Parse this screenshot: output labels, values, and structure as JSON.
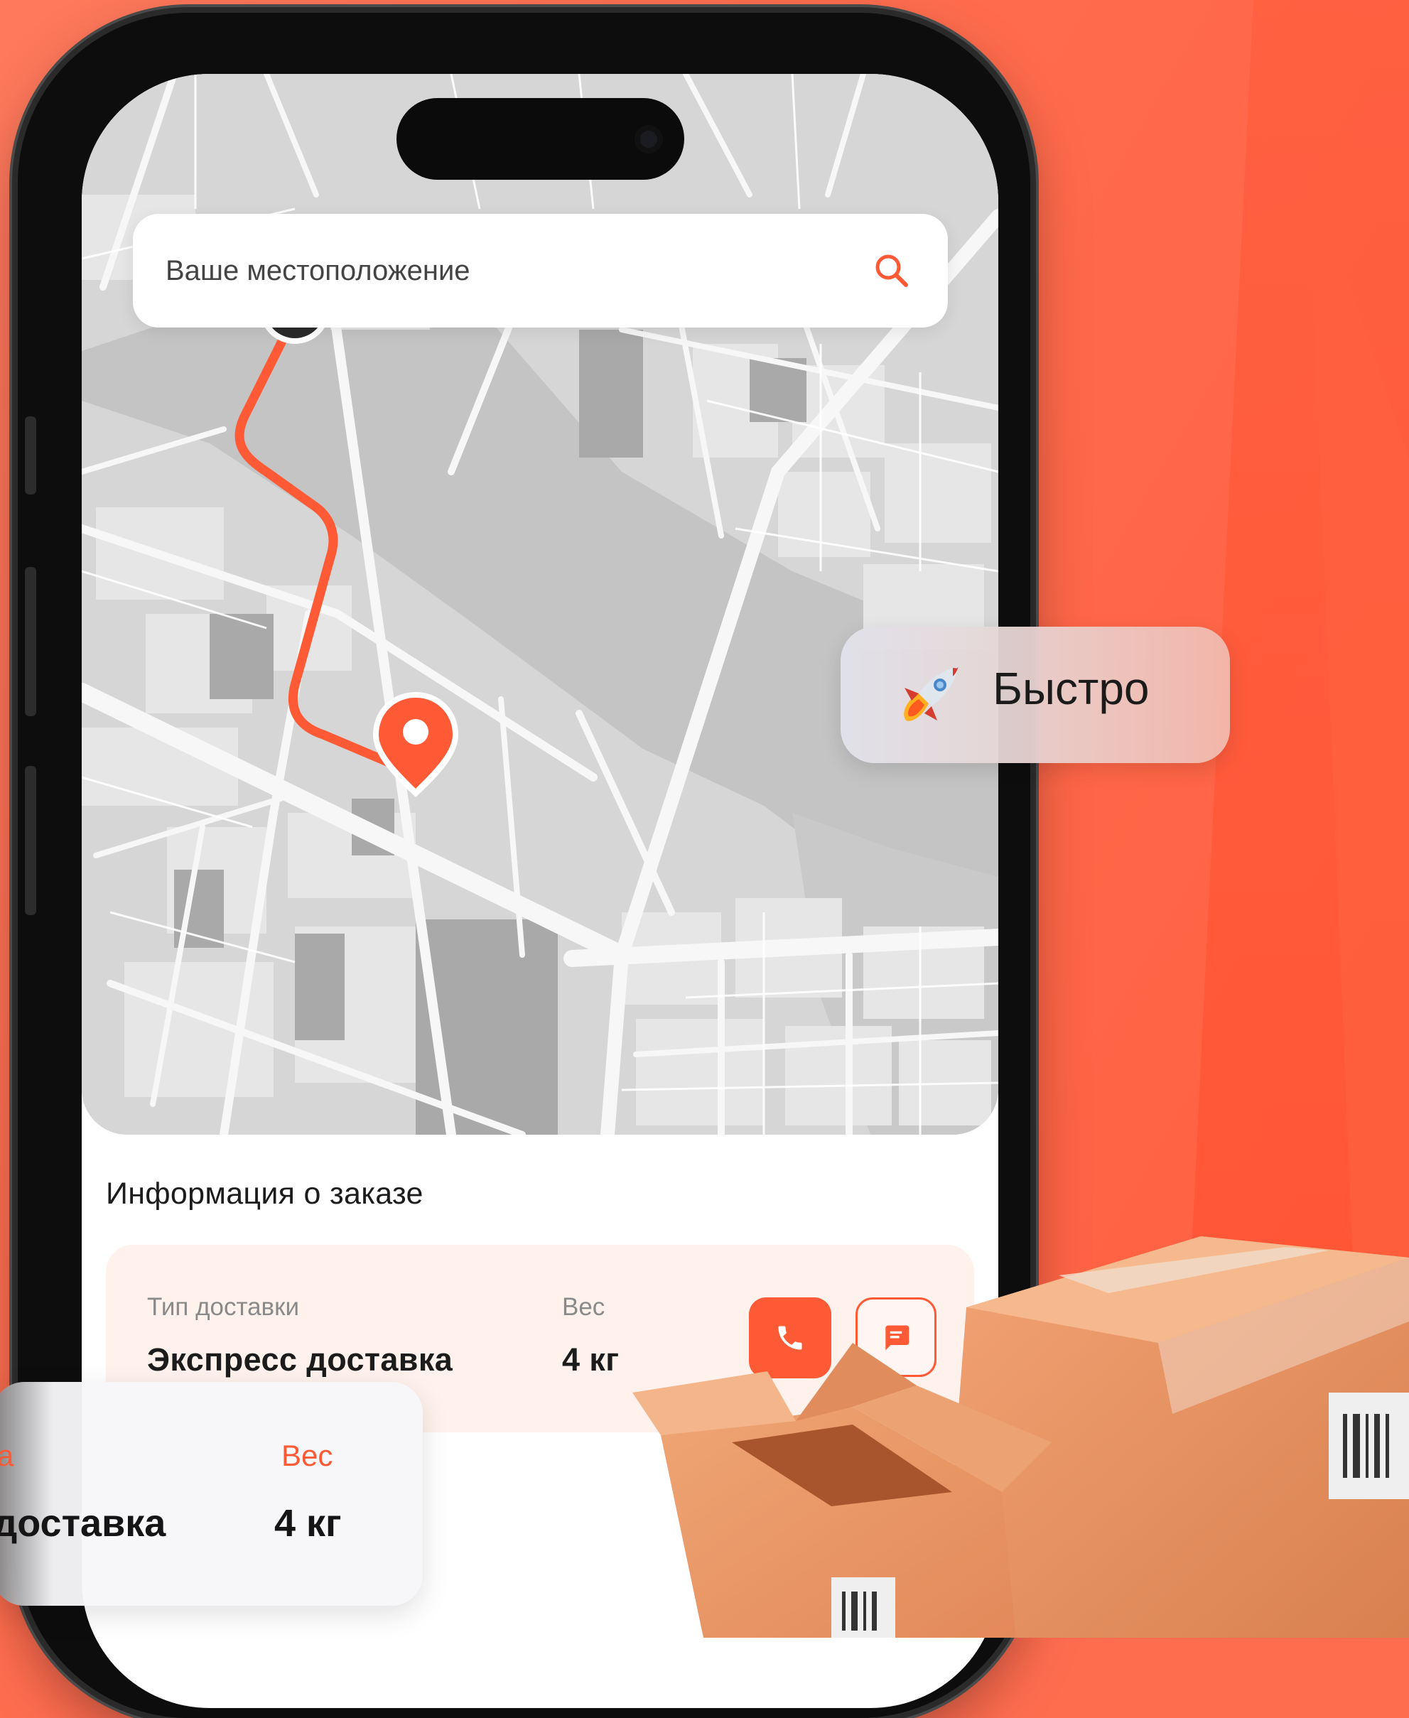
{
  "search": {
    "placeholder": "Ваше местоположение"
  },
  "order": {
    "title": "Информация о заказе",
    "delivery_type_label": "Тип доставки",
    "delivery_type_value": "Экспресс доставка",
    "weight_label": "Вес",
    "weight_value": "4 кг"
  },
  "badge": {
    "text": "Быстро"
  },
  "floating_card": {
    "label_left": "а",
    "label_right": "Вес",
    "value_left": "доставка",
    "value_right": "4 кг"
  },
  "icons": {
    "search": "search-icon",
    "phone": "phone-icon",
    "chat": "chat-icon",
    "rocket": "rocket-icon",
    "start_marker": "start-marker-icon",
    "destination_pin": "destination-pin-icon"
  },
  "colors": {
    "accent": "#ff5a36",
    "background": "#ff6d4f",
    "card_tint": "#fff1ec",
    "route": "#ff5a36"
  }
}
